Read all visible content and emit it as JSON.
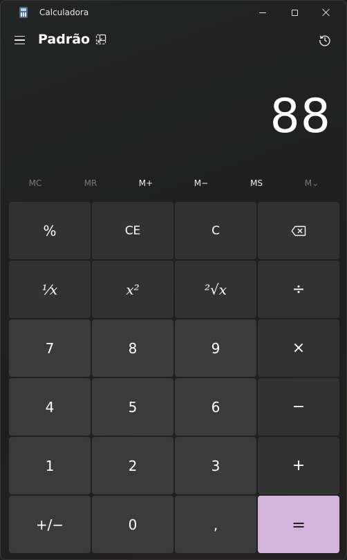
{
  "window": {
    "title": "Calculadora"
  },
  "header": {
    "mode": "Padrão"
  },
  "display": {
    "value": "88"
  },
  "memory": [
    "MC",
    "MR",
    "M+",
    "M−",
    "MS",
    "M⌄"
  ],
  "keys": {
    "percent": "%",
    "clear_entry": "CE",
    "clear": "C",
    "reciprocal": "¹⁄x",
    "square": "x²",
    "sqrt": "²√x",
    "divide": "÷",
    "d7": "7",
    "d8": "8",
    "d9": "9",
    "multiply": "×",
    "d4": "4",
    "d5": "5",
    "d6": "6",
    "minus": "−",
    "d1": "1",
    "d2": "2",
    "d3": "3",
    "plus": "+",
    "negate": "+/−",
    "d0": "0",
    "decimal": ",",
    "equals": "="
  },
  "colors": {
    "accent": "#d3b4dc",
    "background": "#202020",
    "key_number": "#3b3b3b",
    "key_function": "#323232"
  }
}
